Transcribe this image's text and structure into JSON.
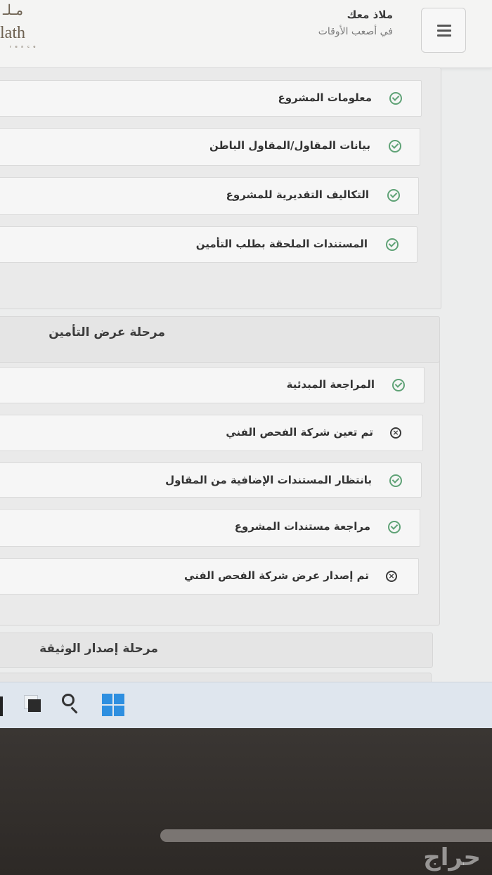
{
  "header": {
    "logo_glyph": "مـلـ",
    "logo_text": "lath",
    "logo_sub": "r e n c e",
    "brand_title": "ملاذ معك",
    "brand_tagline": "في أصعب الأوقات",
    "menu_icon": "hamburger-icon"
  },
  "stage1": {
    "items": [
      {
        "label": "معلومات المشروع",
        "status": "done"
      },
      {
        "label": "بيانات المقاول/المقاول الباطن",
        "status": "done"
      },
      {
        "label": "التكاليف التقديرية للمشروع",
        "status": "done"
      },
      {
        "label": "المستندات الملحقة بطلب التأمين",
        "status": "done"
      }
    ]
  },
  "stage2": {
    "title": "مرحلة عرض التأمين",
    "items": [
      {
        "label": "المراجعة المبدئية",
        "status": "done"
      },
      {
        "label": "تم تعين شركة الفحص الفني",
        "status": "pending"
      },
      {
        "label": "بانتظار المستندات الإضافية من المقاول",
        "status": "done"
      },
      {
        "label": "مراجعة مستندات المشروع",
        "status": "done"
      },
      {
        "label": "تم إصدار عرض شركة الفحص الفني",
        "status": "pending"
      }
    ]
  },
  "stage3": {
    "title": "مرحلة إصدار الوثيقة"
  },
  "taskbar": {
    "icons": [
      "task-view-icon",
      "search-icon",
      "windows-start-icon"
    ]
  },
  "watermark": "حراج",
  "colors": {
    "check_green": "#5fa276",
    "page_bg": "#eceded",
    "card_bg": "#f6f6f6",
    "taskbar_bg": "#dfe6ee",
    "windows_blue": "#2e8fe0"
  }
}
